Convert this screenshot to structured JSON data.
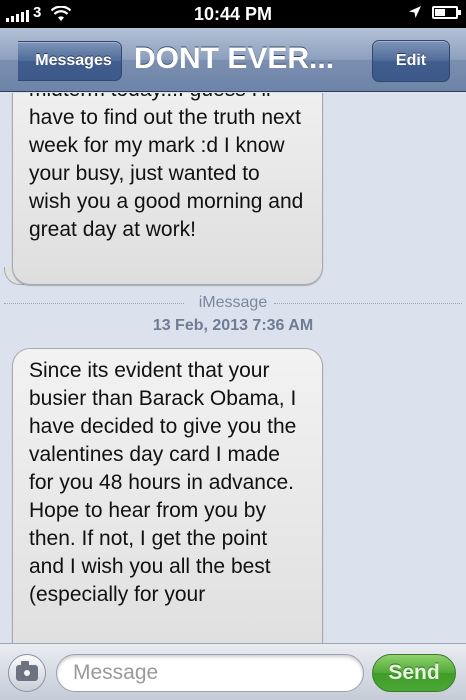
{
  "status_bar": {
    "carrier": "3",
    "time": "10:44 PM"
  },
  "nav": {
    "back_label": "Messages",
    "title": "DONT EVER...",
    "edit_label": "Edit"
  },
  "messages": [
    {
      "sender": "contact",
      "text": "midterm today...I guess I'll have to find out the truth next week for my mark :d I know your busy, just wanted to wish you a good morning and great day at work!"
    },
    {
      "sender": "contact",
      "text": "Since its evident that your busier than Barack Obama, I have decided to give you the valentines day card I made for you 48 hours in advance. Hope to hear from you by then. If not, I get the point and I wish you all the best (especially for your"
    }
  ],
  "divider": {
    "label": "iMessage",
    "timestamp": "13 Feb, 2013 7:36 AM"
  },
  "composer": {
    "placeholder": "Message",
    "send_label": "Send"
  },
  "icons": [
    "signal-icon",
    "wifi-icon",
    "location-icon",
    "battery-icon",
    "camera-icon"
  ]
}
